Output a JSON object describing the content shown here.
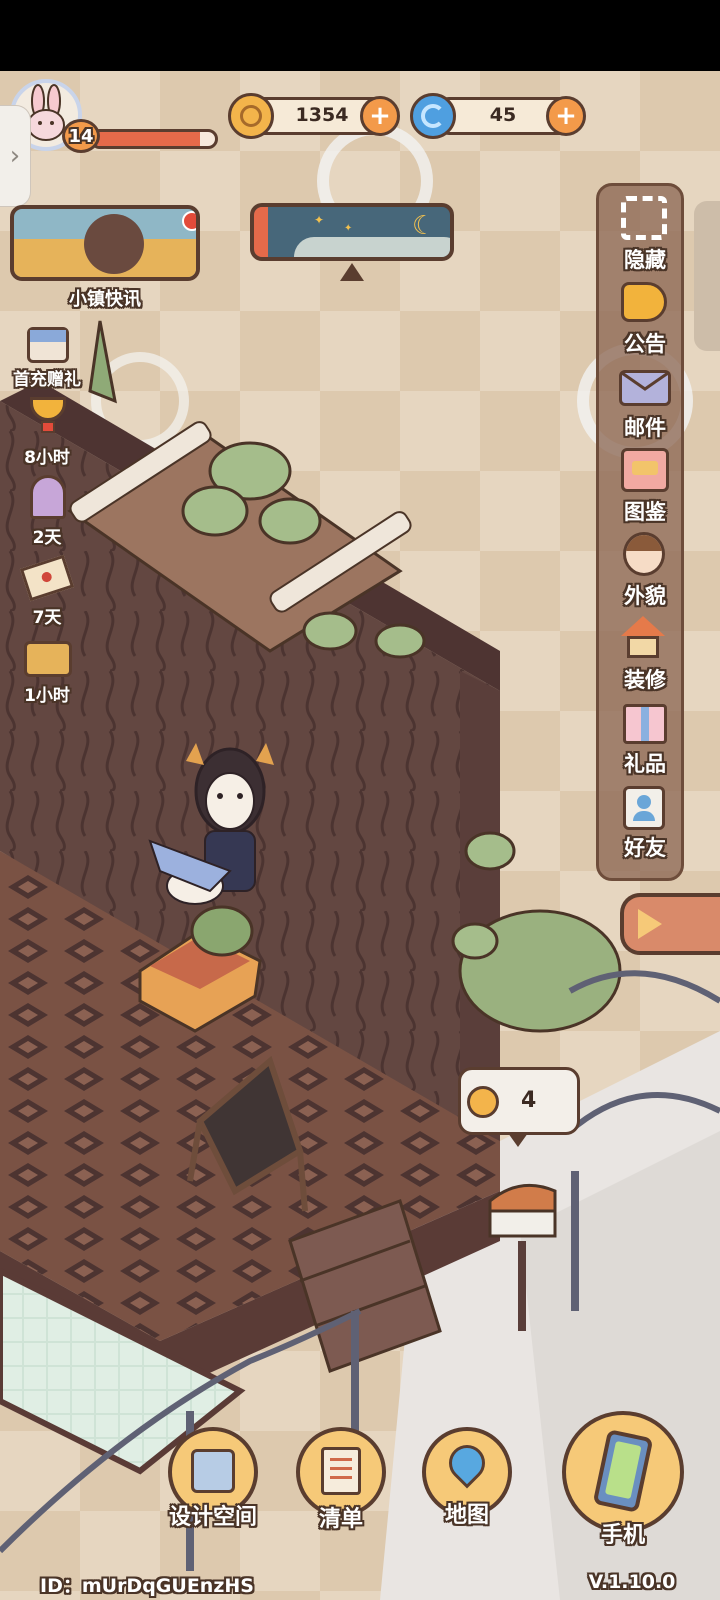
{
  "player": {
    "level": "14"
  },
  "currencies": {
    "coins": "1354",
    "gems": "45"
  },
  "news": {
    "label": "小镇快讯"
  },
  "left_events": [
    {
      "label": "首充赠礼",
      "icon": "gift-box-icon"
    },
    {
      "label": "8小时",
      "icon": "trophy-icon"
    },
    {
      "label": "2天",
      "icon": "gift-jar-icon"
    },
    {
      "label": "7天",
      "icon": "letter-icon"
    },
    {
      "label": "1小时",
      "icon": "treasure-basket-icon"
    }
  ],
  "side_menu": [
    {
      "label": "隐藏",
      "icon": "hide-frame-icon"
    },
    {
      "label": "公告",
      "icon": "megaphone-icon"
    },
    {
      "label": "邮件",
      "icon": "mail-icon"
    },
    {
      "label": "图鉴",
      "icon": "album-icon"
    },
    {
      "label": "外貌",
      "icon": "avatar-face-icon"
    },
    {
      "label": "装修",
      "icon": "house-tools-icon"
    },
    {
      "label": "礼品",
      "icon": "gift-icon"
    },
    {
      "label": "好友",
      "icon": "friends-icon"
    }
  ],
  "coin_bubble": {
    "count": "4"
  },
  "bottom_nav": [
    {
      "label": "设计空间",
      "icon": "design-space-icon"
    },
    {
      "label": "清单",
      "icon": "list-icon"
    },
    {
      "label": "地图",
      "icon": "map-pin-icon"
    },
    {
      "label": "手机",
      "icon": "phone-icon"
    }
  ],
  "footer": {
    "player_id": "ID：mUrDqGUEnzHS",
    "version": "V.1.10.0"
  }
}
